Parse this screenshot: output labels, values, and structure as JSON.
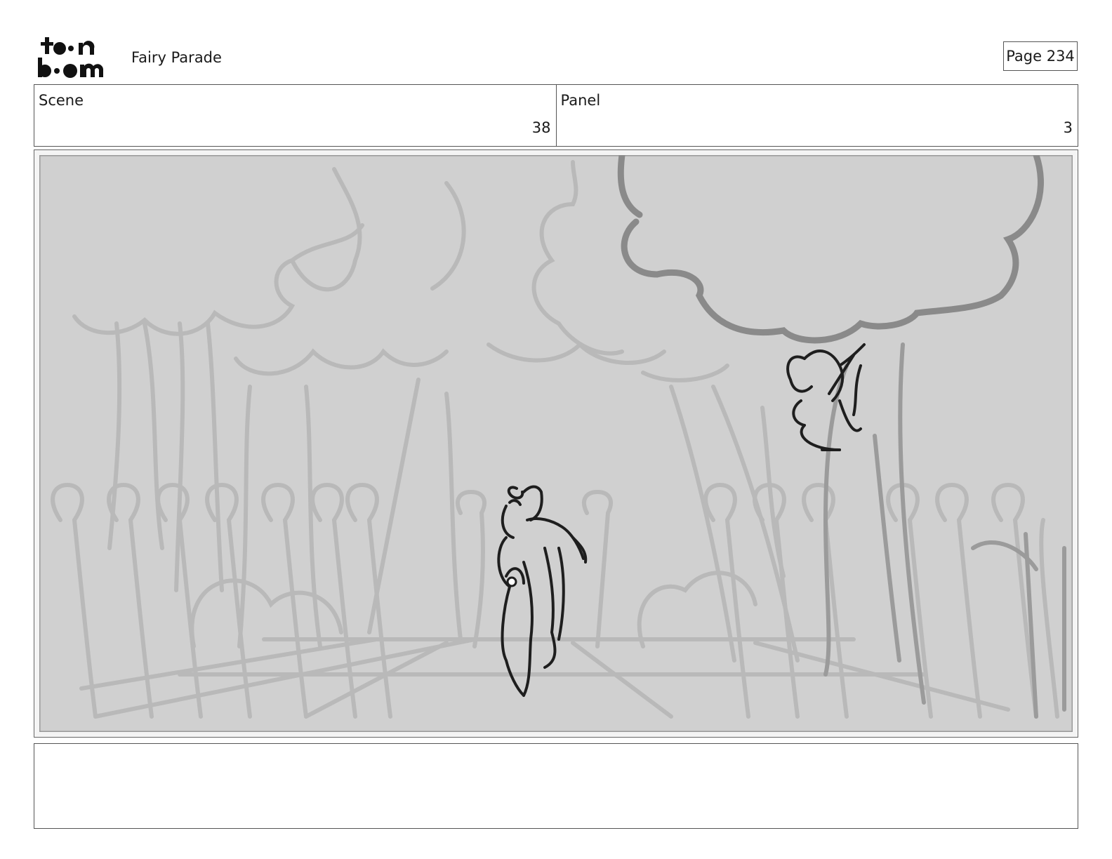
{
  "header": {
    "logo_icon": "toon-boom-logo",
    "project_title": "Fairy Parade",
    "page_label": "Page 234"
  },
  "info": {
    "scene_label": "Scene",
    "scene_value": "38",
    "panel_label": "Panel",
    "panel_value": "3"
  },
  "panel": {
    "image_icon": "storyboard-sketch-forest-parade",
    "background_color": "#d0d0d0",
    "sketch_light_color": "#b9b9b9",
    "sketch_dark_color": "#1e1e1e"
  },
  "notes": {
    "text": ""
  }
}
